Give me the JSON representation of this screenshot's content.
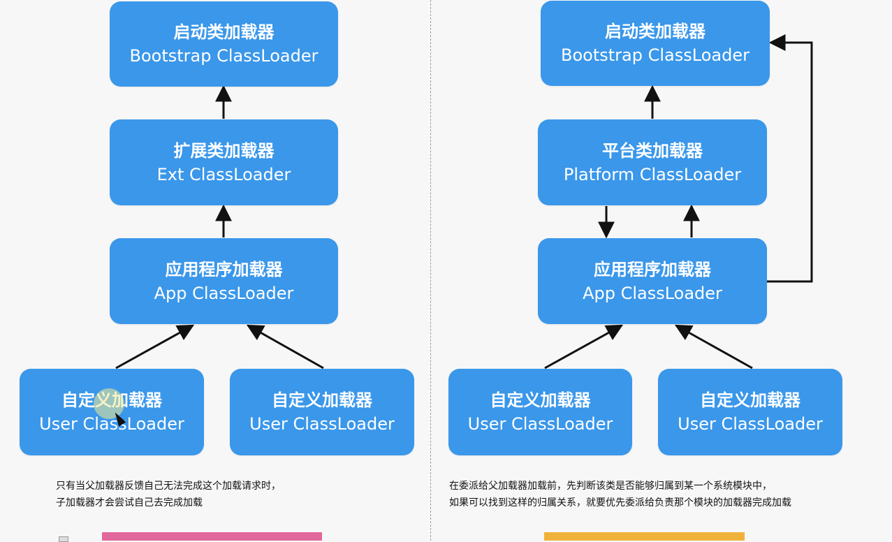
{
  "left": {
    "bootstrap": {
      "cn": "启动类加载器",
      "en": "Bootstrap ClassLoader"
    },
    "ext": {
      "cn": "扩展类加载器",
      "en": "Ext ClassLoader"
    },
    "app": {
      "cn": "应用程序加载器",
      "en": "App ClassLoader"
    },
    "user1": {
      "cn": "自定义加载器",
      "en": "User ClassLoader"
    },
    "user2": {
      "cn": "自定义加载器",
      "en": "User ClassLoader"
    },
    "note": [
      "只有当父加载器反馈自己无法完成这个加载请求时，",
      "子加载器才会尝试自己去完成加载"
    ]
  },
  "right": {
    "bootstrap": {
      "cn": "启动类加载器",
      "en": "Bootstrap ClassLoader"
    },
    "platform": {
      "cn": "平台类加载器",
      "en": "Platform ClassLoader"
    },
    "app": {
      "cn": "应用程序加载器",
      "en": "App ClassLoader"
    },
    "user1": {
      "cn": "自定义加载器",
      "en": "User ClassLoader"
    },
    "user2": {
      "cn": "自定义加载器",
      "en": "User ClassLoader"
    },
    "note": [
      "在委派给父加载器加载前，先判断该类是否能够归属到某一个系统模块中，",
      "如果可以找到这样的归属关系，就要优先委派给负责那个模块的加载器完成加载"
    ]
  },
  "colors": {
    "box": "#3a97ea",
    "arrow": "#111111",
    "left_bar": "#e1679c",
    "right_bar": "#f0b23a"
  }
}
